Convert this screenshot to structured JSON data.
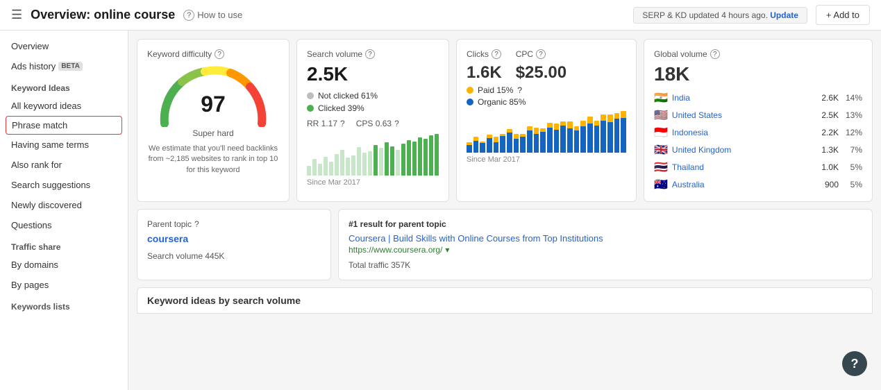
{
  "topNav": {
    "hamburger": "☰",
    "title": "Overview: online course",
    "howToUse": "How to use",
    "updateBadge": "SERP & KD updated 4 hours ago.",
    "updateLink": "Update",
    "addTo": "+ Add to"
  },
  "sidebar": {
    "overview": "Overview",
    "adsHistory": "Ads history",
    "adsBeta": "BETA",
    "keywordIdeas": "Keyword Ideas",
    "allKeywordIdeas": "All keyword ideas",
    "phraseMatch": "Phrase match",
    "havingSameTerms": "Having same terms",
    "alsoRankFor": "Also rank for",
    "searchSuggestions": "Search suggestions",
    "newlyDiscovered": "Newly discovered",
    "questions": "Questions",
    "trafficShare": "Traffic share",
    "byDomains": "By domains",
    "byPages": "By pages",
    "keywordsLists": "Keywords lists"
  },
  "kd": {
    "label": "Keyword difficulty",
    "value": 97,
    "sublabel": "Super hard",
    "desc": "We estimate that you'll need backlinks from ~2,185 websites to rank in top 10 for this keyword"
  },
  "sv": {
    "label": "Search volume",
    "value": "2.5K",
    "notClicked": "Not clicked 61%",
    "clicked": "Clicked 39%",
    "rr": "RR 1.17",
    "cps": "CPS 0.63",
    "since": "Since Mar 2017",
    "bars": [
      20,
      35,
      25,
      40,
      30,
      45,
      55,
      38,
      42,
      60,
      48,
      52,
      65,
      58,
      70,
      62,
      55,
      68,
      75,
      72,
      80,
      78,
      85,
      88
    ]
  },
  "clicks": {
    "label": "Clicks",
    "value": "1.6K",
    "cpcLabel": "CPC",
    "cpcValue": "$25.00",
    "paid": "Paid 15%",
    "organic": "Organic 85%",
    "since": "Since Mar 2017",
    "bars_paid": [
      5,
      8,
      3,
      6,
      10,
      4,
      7,
      9,
      5,
      8,
      12,
      6,
      9,
      11,
      7,
      13,
      8,
      10,
      14,
      9,
      12,
      15,
      11,
      13
    ],
    "bars_organic": [
      15,
      22,
      18,
      28,
      20,
      32,
      38,
      27,
      30,
      42,
      35,
      40,
      48,
      44,
      52,
      46,
      42,
      50,
      55,
      52,
      60,
      58,
      64,
      66
    ]
  },
  "gv": {
    "label": "Global volume",
    "value": "18K",
    "countries": [
      {
        "flag": "🇮🇳",
        "name": "India",
        "vol": "2.6K",
        "pct": "14%"
      },
      {
        "flag": "🇺🇸",
        "name": "United States",
        "vol": "2.5K",
        "pct": "13%"
      },
      {
        "flag": "🇮🇩",
        "name": "Indonesia",
        "vol": "2.2K",
        "pct": "12%"
      },
      {
        "flag": "🇬🇧",
        "name": "United Kingdom",
        "vol": "1.3K",
        "pct": "7%"
      },
      {
        "flag": "🇹🇭",
        "name": "Thailand",
        "vol": "1.0K",
        "pct": "5%"
      },
      {
        "flag": "🇦🇺",
        "name": "Australia",
        "vol": "900",
        "pct": "5%"
      }
    ]
  },
  "parentTopic": {
    "label": "Parent topic",
    "topicLink": "coursera",
    "sv": "Search volume 445K"
  },
  "result": {
    "label": "#1 result for parent topic",
    "linkText": "Coursera | Build Skills with Online Courses from Top Institutions",
    "url": "https://www.coursera.org/",
    "traffic": "Total traffic 357K"
  },
  "keywordIdeas": {
    "label": "Keyword ideas by search volume"
  },
  "help": "?"
}
